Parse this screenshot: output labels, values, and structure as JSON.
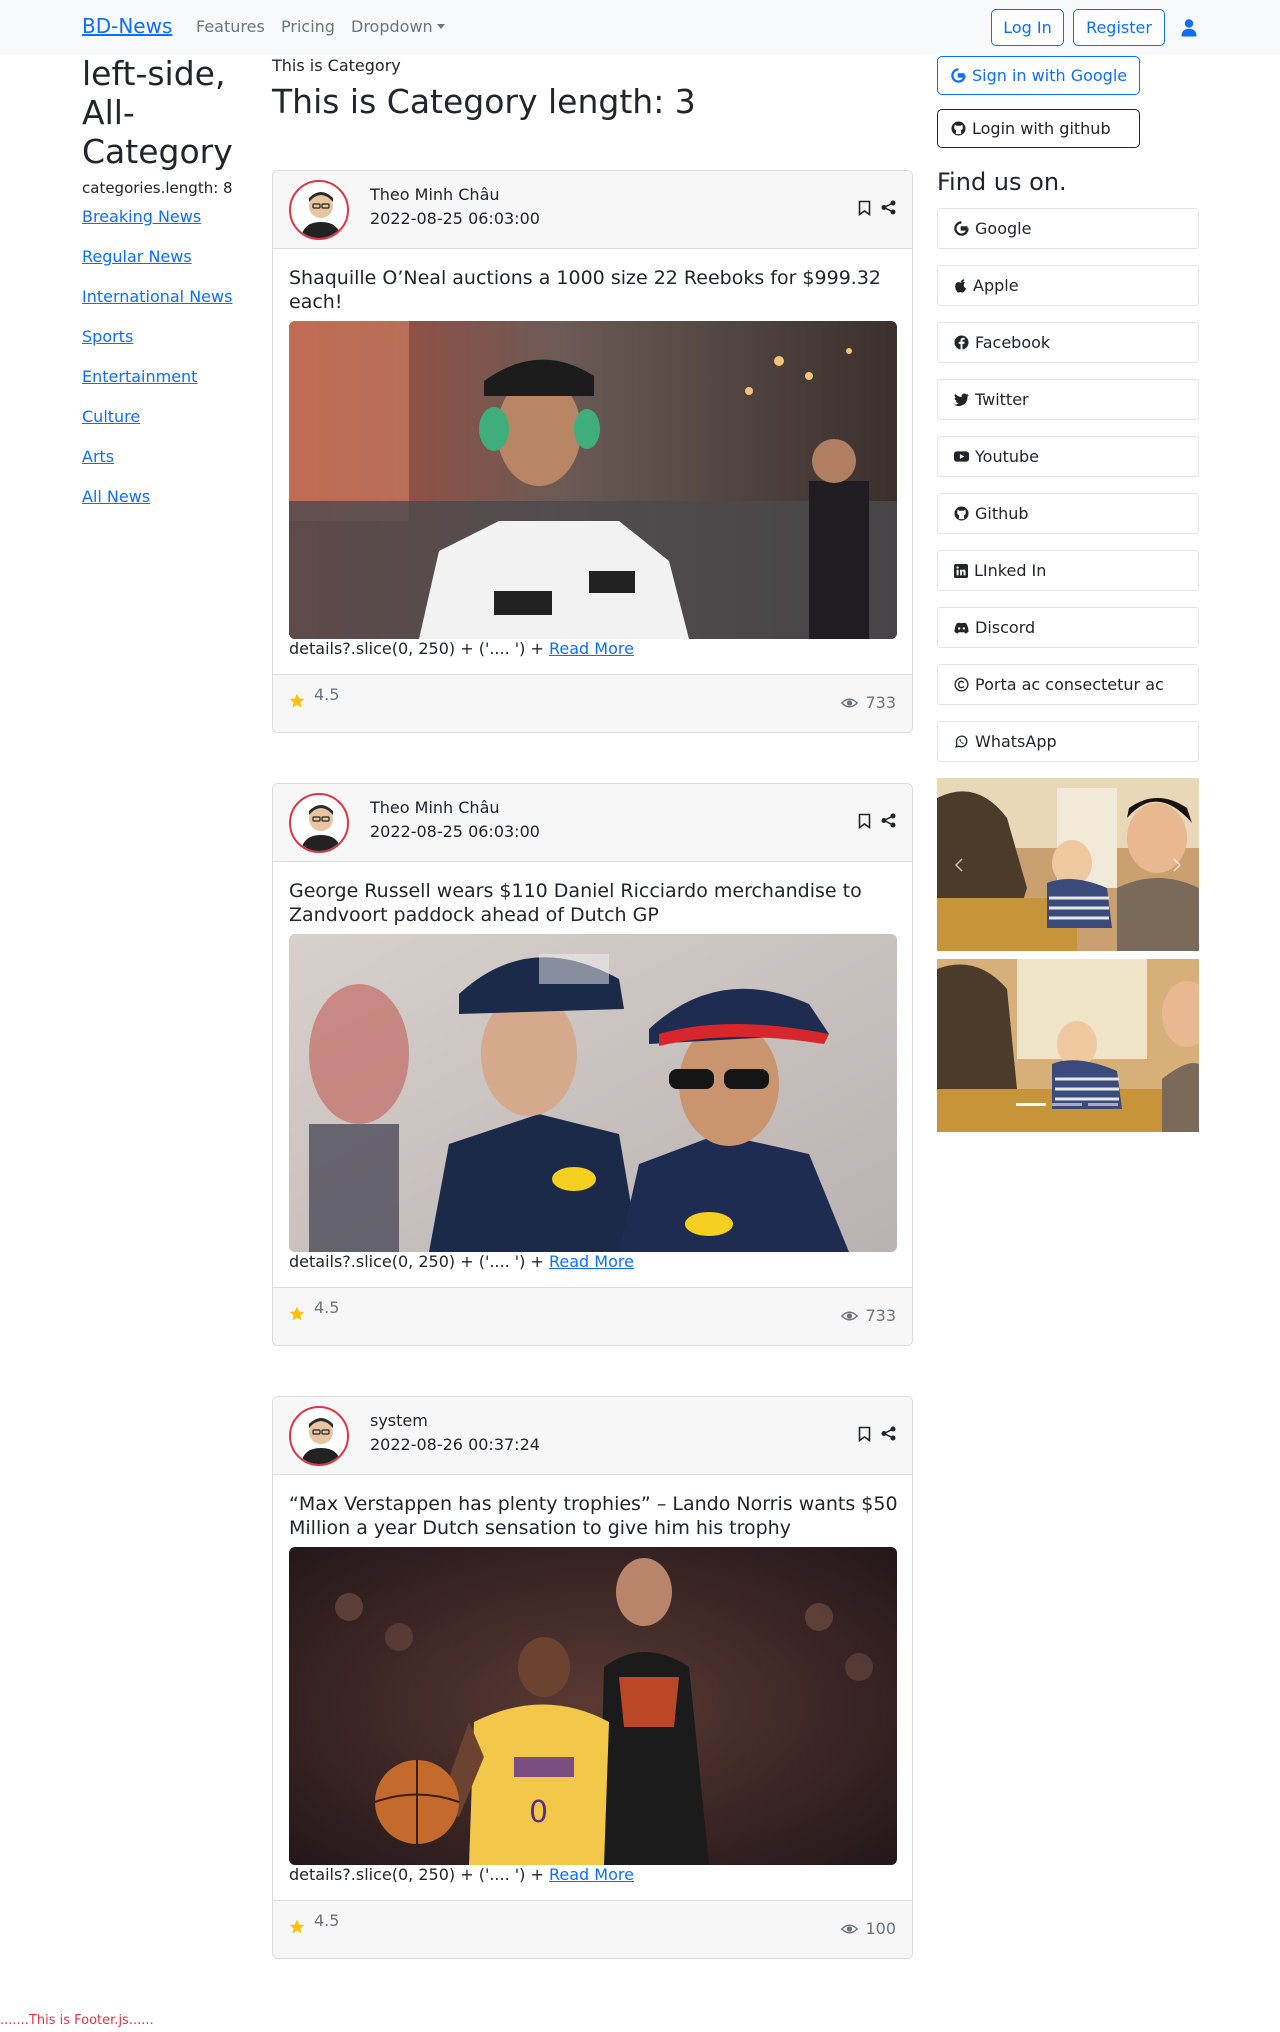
{
  "navbar": {
    "brand": "BD-News",
    "links": [
      "Features",
      "Pricing",
      "Dropdown"
    ],
    "login": "Log In",
    "register": "Register"
  },
  "left": {
    "title": "left-side, All-Category",
    "count": "categories.length: 8",
    "categories": [
      "Breaking News",
      "Regular News",
      "International News",
      "Sports",
      "Entertainment",
      "Culture",
      "Arts",
      "All News"
    ]
  },
  "main": {
    "crumb": "This is Category",
    "title": "This is Category length: 3"
  },
  "posts": [
    {
      "author": "Theo Minh Châu",
      "date": "2022-08-25 06:03:00",
      "title": "Shaquille O’Neal auctions a 1000 size 22 Reeboks for $999.32 each!",
      "details": "details?.slice(0, 250) + ('.... ') +",
      "read_more": "Read More",
      "rating": "4.5",
      "views": "733"
    },
    {
      "author": "Theo Minh Châu",
      "date": "2022-08-25 06:03:00",
      "title": "George Russell wears $110 Daniel Ricciardo merchandise to Zandvoort paddock ahead of Dutch GP",
      "details": "details?.slice(0, 250) + ('.... ') +",
      "read_more": "Read More",
      "rating": "4.5",
      "views": "733"
    },
    {
      "author": "system",
      "date": "2022-08-26 00:37:24",
      "title": "“Max Verstappen has plenty trophies” – Lando Norris wants $50 Million a year Dutch sensation to give him his trophy",
      "details": "details?.slice(0, 250) + ('.... ') +",
      "read_more": "Read More",
      "rating": "4.5",
      "views": "100"
    }
  ],
  "right": {
    "google_signin": "Sign in with Google",
    "github_login": "Login with github",
    "find_us": "Find us on.",
    "socials": [
      "Google",
      "Apple",
      "Facebook",
      "Twitter",
      "Youtube",
      "Github",
      "LInked In",
      "Discord",
      "Porta ac consectetur ac",
      "WhatsApp"
    ],
    "icons": [
      "google-icon",
      "apple-icon",
      "facebook-icon",
      "twitter-icon",
      "youtube-icon",
      "github-icon",
      "linkedin-icon",
      "discord-icon",
      "copyright-icon",
      "whatsapp-icon"
    ]
  },
  "footer": {
    "text": ".......This is Footer.js......"
  },
  "colors": {
    "primary": "#0d6efd",
    "danger": "#dc3545",
    "muted": "#6c757d",
    "star": "#ffc107"
  }
}
